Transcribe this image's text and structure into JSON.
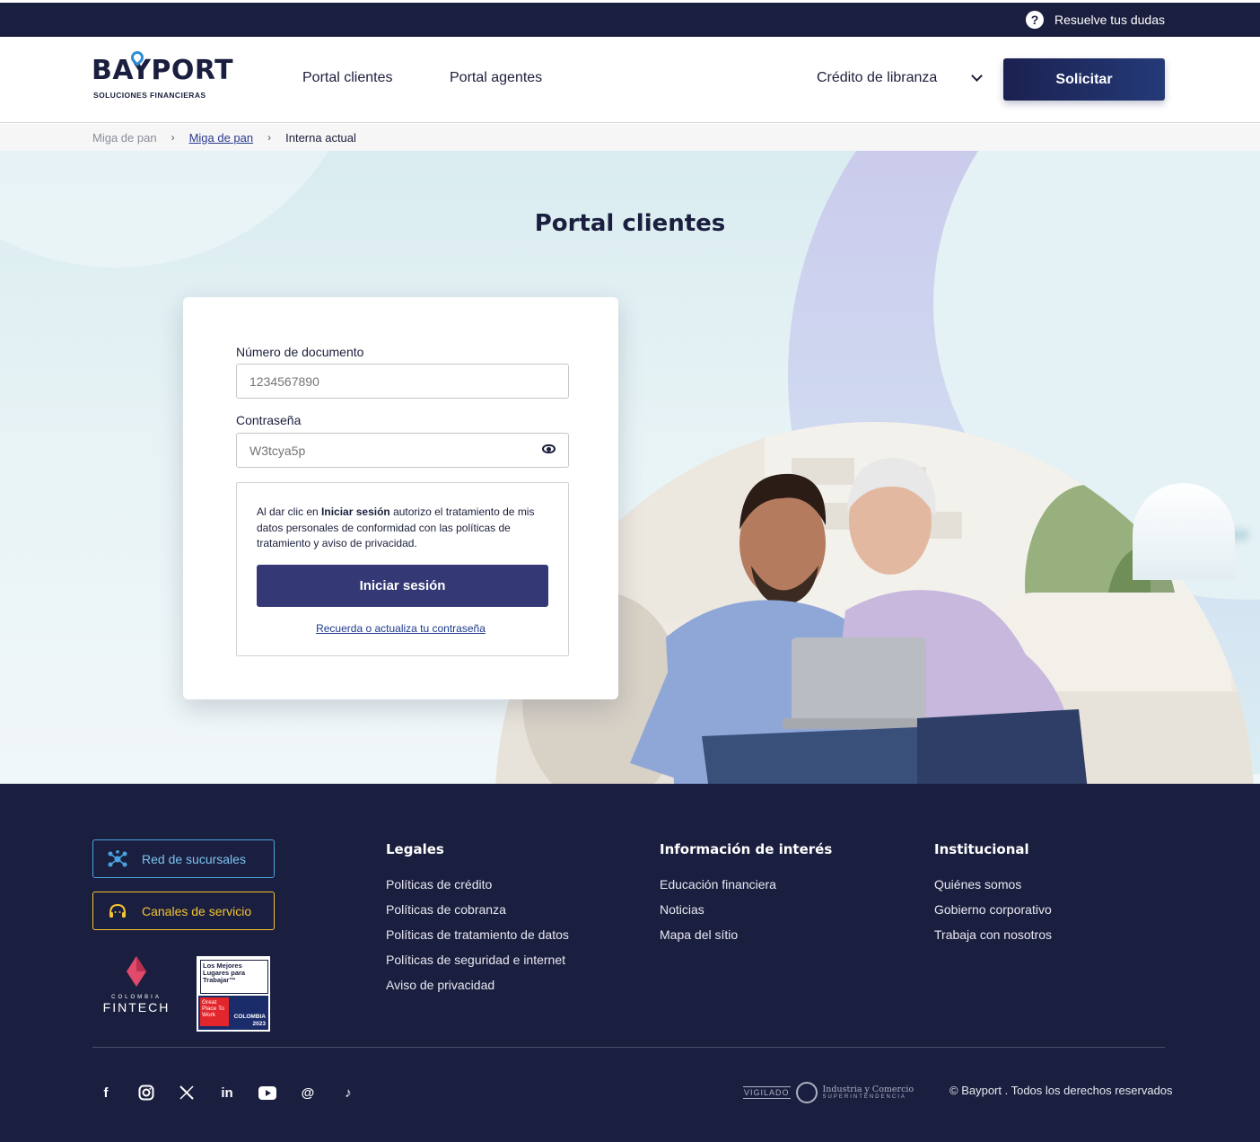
{
  "topbar": {
    "help_label": "Resuelve tus dudas",
    "help_icon": "question-circle-icon"
  },
  "header": {
    "logo_text": "BAYPORT",
    "logo_subtitle": "SOLUCIONES FINANCIERAS",
    "nav": [
      "Portal clientes",
      "Portal agentes"
    ],
    "product_select": "Crédito de libranza",
    "cta_label": "Solicitar"
  },
  "breadcrumb": {
    "items": [
      "Miga de pan",
      "Miga de pan",
      "Interna actual"
    ]
  },
  "hero": {
    "title": "Portal clientes"
  },
  "login": {
    "document_label": "Número de documento",
    "document_placeholder": "1234567890",
    "password_label": "Contraseña",
    "password_value": "W3tcya5p",
    "consent_prefix": "Al dar clic en ",
    "consent_bold": "Iniciar sesión",
    "consent_suffix": " autorizo el tratamiento de mis datos personales de conformidad con las políticas de tratamiento y aviso de privacidad.",
    "submit_label": "Iniciar sesión",
    "recover_link": "Recuerda o actualiza tu contraseña"
  },
  "footer": {
    "branch_button": "Red de sucursales",
    "service_button": "Canales de servicio",
    "fintech_small": "COLOMBIA",
    "fintech_big": "FINTECH",
    "gptw_title": "Los Mejores Lugares para Trabajar™",
    "gptw_badge": "Great Place To Work",
    "gptw_country": "COLOMBIA",
    "gptw_year": "2023",
    "columns": [
      {
        "title": "Legales",
        "links": [
          "Políticas de crédito",
          "Políticas de cobranza",
          "Políticas de tratamiento de datos",
          "Políticas de seguridad e internet",
          "Aviso de privacidad"
        ]
      },
      {
        "title": "Información de interés",
        "links": [
          "Educación financiera",
          "Noticias",
          "Mapa del sítio"
        ]
      },
      {
        "title": "Institucional",
        "links": [
          "Quiénes somos",
          "Gobierno corporativo",
          "Trabaja con nosotros"
        ]
      }
    ],
    "socials": [
      "facebook-icon",
      "instagram-icon",
      "x-icon",
      "linkedin-icon",
      "youtube-icon",
      "threads-icon",
      "tiktok-icon"
    ],
    "vigilado": "VIGILADO",
    "sic_name": "Industria y Comercio",
    "sic_sub": "SUPERINTENDENCIA",
    "copyright": "© Bayport . Todos los derechos reservados"
  },
  "colors": {
    "navy": "#1b1f3f",
    "button": "#343875",
    "accent_blue": "#4aa3e0",
    "accent_yellow": "#f4c430"
  }
}
